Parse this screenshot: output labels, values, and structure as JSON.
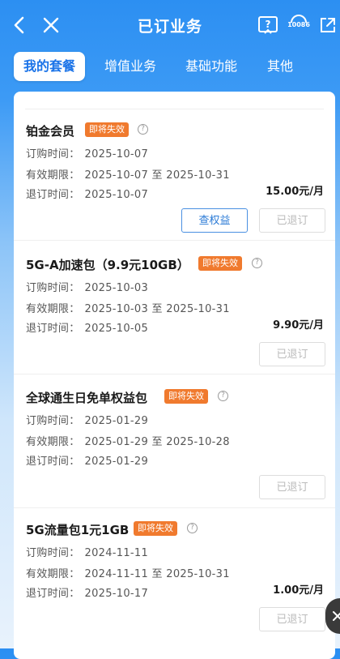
{
  "header": {
    "title": "已订业务",
    "service_number": "10086",
    "icons": [
      "back-arrow-icon",
      "close-icon",
      "help-book-icon",
      "customer-service-icon",
      "share-icon"
    ]
  },
  "tabs": [
    {
      "label": "我的套餐",
      "active": true
    },
    {
      "label": "增值业务",
      "active": false
    },
    {
      "label": "基础功能",
      "active": false
    },
    {
      "label": "其他",
      "active": false
    }
  ],
  "labels": {
    "order_time": "订购时间：",
    "valid_period": "有效期限：",
    "unsubscribe_time": "退订时间：",
    "to": "至"
  },
  "colors": {
    "primary": "#1a73e8",
    "badge": "#f07a2e",
    "header_bg": "#2c8ff2"
  },
  "cards": [
    {
      "name": "铂金会员",
      "badge": "即将失效",
      "order_time": "2025-10-07",
      "valid_from": "2025-10-07",
      "valid_to": "2025-10-31",
      "unsubscribe_time": "2025-10-07",
      "price": "15.00元/月",
      "rights_button": "查权益",
      "status_button": "已退订"
    },
    {
      "name": "5G-A加速包（9.9元10GB）",
      "badge": "即将失效",
      "order_time": "2025-10-03",
      "valid_from": "2025-10-03",
      "valid_to": "2025-10-31",
      "unsubscribe_time": "2025-10-05",
      "price": "9.90元/月",
      "status_button": "已退订"
    },
    {
      "name": "全球通生日免单权益包",
      "badge": "即将失效",
      "order_time": "2025-01-29",
      "valid_from": "2025-01-29",
      "valid_to": "2025-10-28",
      "unsubscribe_time": "2025-01-29",
      "status_button": "已退订"
    },
    {
      "name": "5G流量包1元1GB",
      "badge": "即将失效",
      "order_time": "2024-11-11",
      "valid_from": "2024-11-11",
      "valid_to": "2025-10-31",
      "unsubscribe_time": "2025-10-17",
      "price": "1.00元/月",
      "status_button": "已退订"
    }
  ]
}
